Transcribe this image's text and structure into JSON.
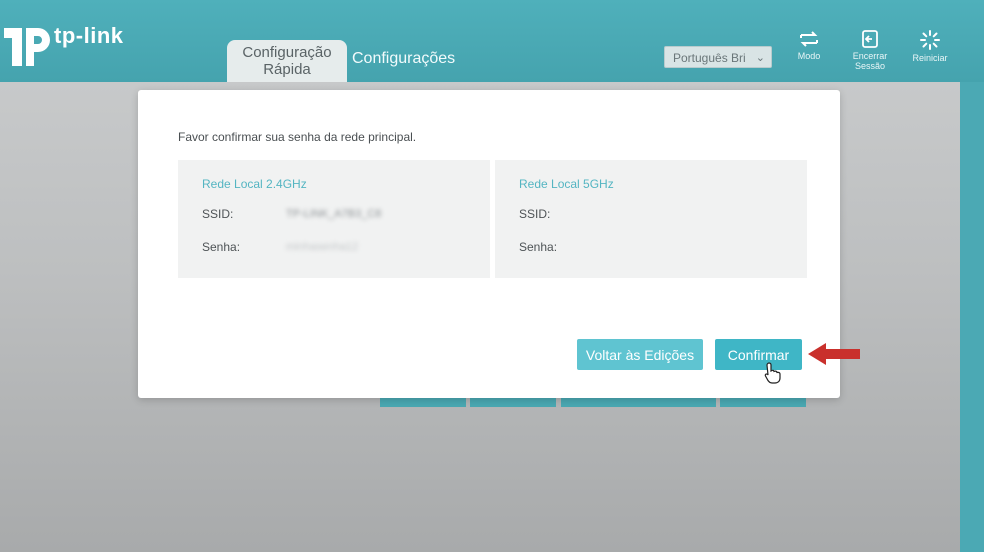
{
  "brand": {
    "logo_text": "tp-link"
  },
  "nav": {
    "tab_quick_line1": "Configuração",
    "tab_quick_line2": "Rápida",
    "tab_settings": "Configurações"
  },
  "language": {
    "selected": "Português Bri"
  },
  "actions": {
    "mode": "Modo",
    "logout_line1": "Encerrar",
    "logout_line2": "Sessão",
    "reboot": "Reiniciar"
  },
  "modal": {
    "message": "Favor confirmar sua senha da rede principal.",
    "network_24": {
      "title": "Rede Local 2.4GHz",
      "ssid_label": "SSID:",
      "ssid_value": "TP-LINK_A7B3_C8",
      "password_label": "Senha:",
      "password_value": "minhasenha12"
    },
    "network_5": {
      "title": "Rede Local 5GHz",
      "ssid_label": "SSID:",
      "password_label": "Senha:"
    },
    "back_button": "Voltar às Edições",
    "confirm_button": "Confirmar"
  },
  "colors": {
    "header_teal": "#4ba9b4",
    "accent": "#3fb6c6",
    "arrow_red": "#c9302c"
  }
}
